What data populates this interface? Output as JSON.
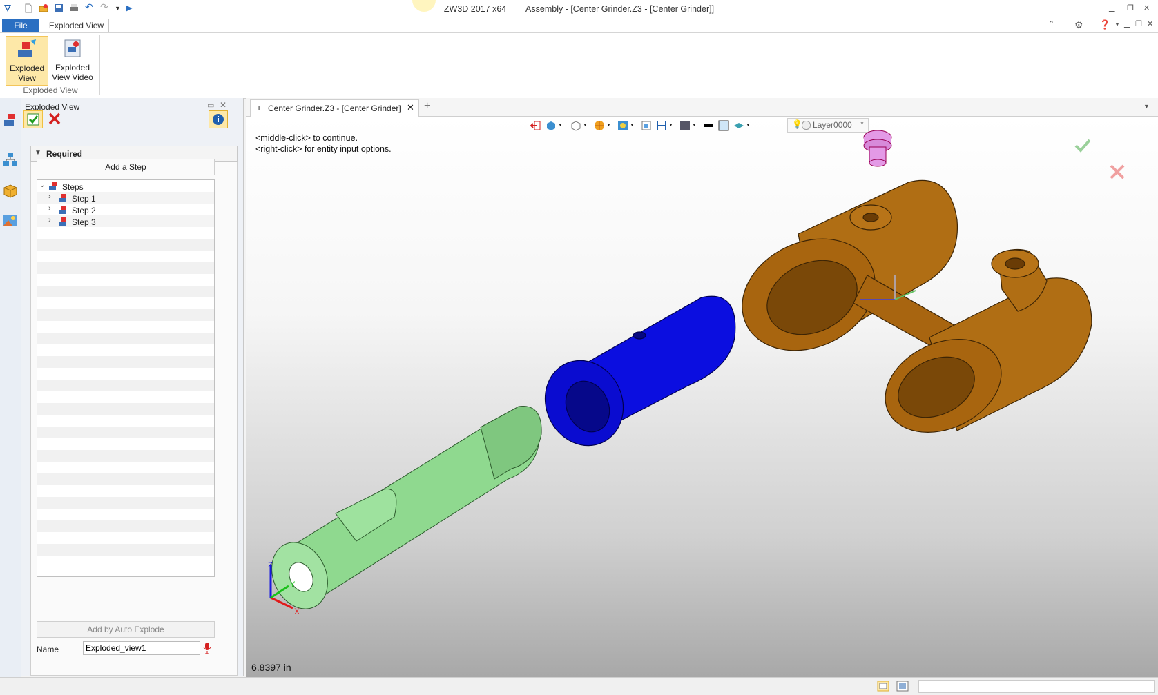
{
  "titlebar": {
    "app": "ZW3D 2017  x64",
    "doc": "Assembly - [Center Grinder.Z3 - [Center Grinder]]"
  },
  "ribbon": {
    "file_tab": "File",
    "active_tab": "Exploded View",
    "buttons": [
      {
        "line1": "Exploded",
        "line2": "View"
      },
      {
        "line1": "Exploded",
        "line2": "View Video"
      }
    ],
    "group_label": "Exploded View"
  },
  "panel": {
    "title": "Exploded View",
    "required_label": "Required",
    "add_step": "Add a Step",
    "tree": {
      "root": "Steps",
      "steps": [
        "Step 1",
        "Step 2",
        "Step 3"
      ]
    },
    "auto_explode": "Add by Auto Explode",
    "name_label": "Name",
    "name_value": "Exploded_view1"
  },
  "viewport": {
    "doc_tab": "Center Grinder.Z3 - [Center Grinder]",
    "hint1": "<middle-click> to continue.",
    "hint2": "<right-click> for entity input options.",
    "layer": "Layer0000",
    "measure": "6.8397 in",
    "axes": {
      "x": "X",
      "y": "Y",
      "z": "Z"
    }
  },
  "colors": {
    "shaft": "#8fd98f",
    "sleeve": "#0b0ee0",
    "housing": "#b06e14",
    "screw": "#e39ae6",
    "accent": "#2a6fc2"
  }
}
